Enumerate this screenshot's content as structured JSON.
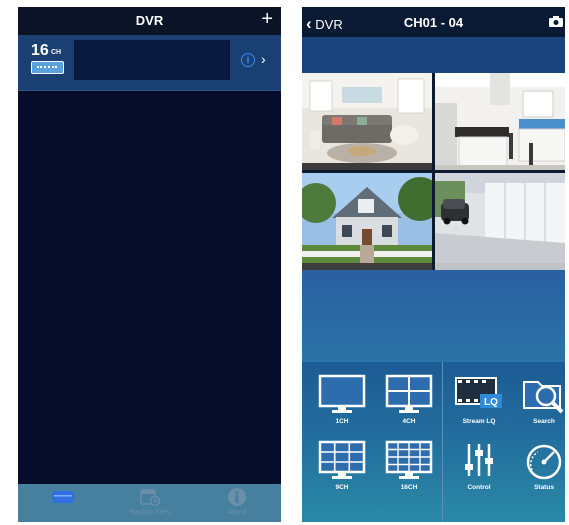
{
  "left_screen": {
    "header": {
      "title": "DVR",
      "add_icon": "plus-icon"
    },
    "device": {
      "channels": "16",
      "channel_unit": "CH",
      "info_icon": "info-icon",
      "chevron_icon": "chevron-right-icon"
    },
    "tabs": [
      {
        "label": "",
        "icon": "dvr-device-icon",
        "active": true
      },
      {
        "label": "Backup Files",
        "icon": "backup-files-icon",
        "active": false
      },
      {
        "label": "About",
        "icon": "about-icon",
        "active": false
      }
    ]
  },
  "right_screen": {
    "header": {
      "back_label": "DVR",
      "title": "CH01 - 04",
      "camera_icon": "camera-icon"
    },
    "cameras": [
      {
        "scene": "living-room"
      },
      {
        "scene": "kitchen"
      },
      {
        "scene": "house-exterior"
      },
      {
        "scene": "garage"
      }
    ],
    "controls": [
      {
        "label": "1CH",
        "icon": "single-view-icon"
      },
      {
        "label": "4CH",
        "icon": "quad-view-icon"
      },
      {
        "label": "Stream LQ",
        "icon": "stream-quality-icon",
        "badge": "LQ"
      },
      {
        "label": "Search",
        "icon": "search-folder-icon"
      },
      {
        "label": "9CH",
        "icon": "nine-view-icon"
      },
      {
        "label": "16CH",
        "icon": "sixteen-view-icon"
      },
      {
        "label": "Control",
        "icon": "control-sliders-icon"
      },
      {
        "label": "Status",
        "icon": "status-gauge-icon"
      }
    ]
  },
  "colors": {
    "header_bg": "#0b1426",
    "device_row_bg": "#1a3f72",
    "accent_blue": "#3c8cf0",
    "tab_bar": "#46809e"
  }
}
